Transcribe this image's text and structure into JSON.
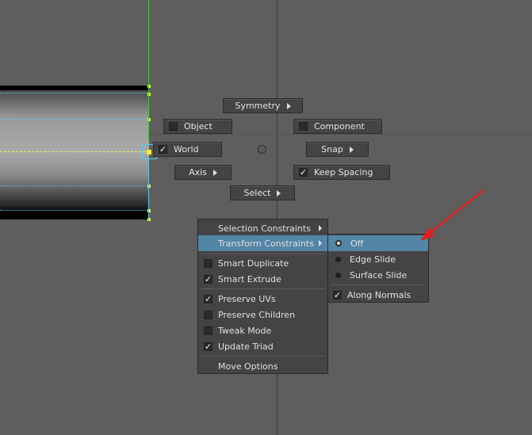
{
  "marking_menu": {
    "symmetry": "Symmetry",
    "object": "Object",
    "component": "Component",
    "world": "World",
    "snap": "Snap",
    "axis": "Axis",
    "keep_spacing": "Keep Spacing",
    "select": "Select"
  },
  "context_menu": {
    "items": [
      {
        "label": "Selection Constraints"
      },
      {
        "label": "Transform Constraints"
      },
      {
        "label": "Smart Duplicate",
        "checked": false
      },
      {
        "label": "Smart Extrude",
        "checked": true
      },
      {
        "label": "Preserve UVs",
        "checked": true
      },
      {
        "label": "Preserve Children",
        "checked": false
      },
      {
        "label": "Tweak Mode",
        "checked": false
      },
      {
        "label": "Update Triad",
        "checked": true
      },
      {
        "label": "Move Options"
      }
    ]
  },
  "submenu": {
    "items": [
      {
        "label": "Off",
        "selected": true
      },
      {
        "label": "Edge Slide",
        "selected": false
      },
      {
        "label": "Surface Slide",
        "selected": false
      },
      {
        "label": "Along Normals",
        "checked": true
      }
    ]
  },
  "checkmark_glyph": "✓",
  "colors": {
    "background": "#5e5e5e",
    "highlight": "#5285a6",
    "arrow": "#e02020",
    "y_axis": "#3cc83c",
    "selection": "#58c8e8"
  }
}
